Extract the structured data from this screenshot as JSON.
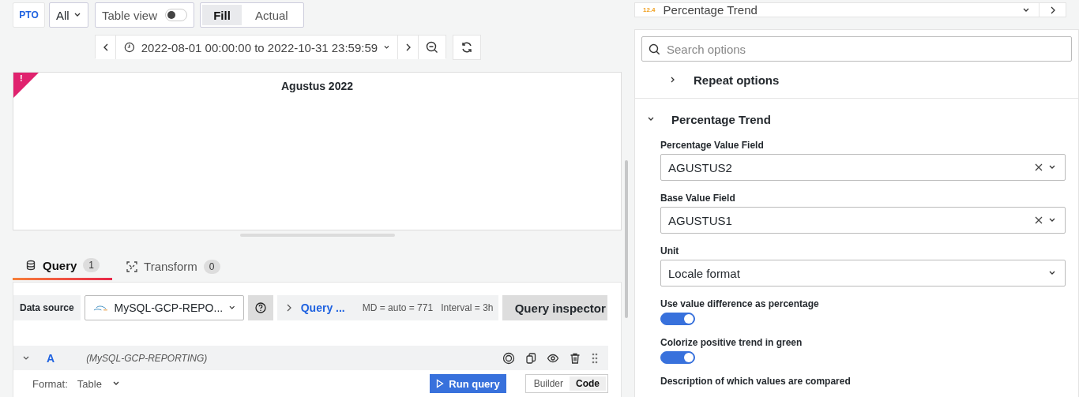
{
  "toolbar": {
    "pto_button": "PTO",
    "variable_dropdown": "All",
    "table_view": {
      "label": "Table view",
      "on": false
    },
    "fill_modes": [
      {
        "label": "Fill",
        "selected": true
      },
      {
        "label": "Actual",
        "selected": false
      }
    ]
  },
  "time_range": {
    "value": "2022-08-01 00:00:00 to 2022-10-31 23:59:59"
  },
  "panel": {
    "title": "Agustus 2022",
    "error_mark": "!"
  },
  "editor_tabs": [
    {
      "label": "Query",
      "count": "1",
      "selected": true
    },
    {
      "label": "Transform",
      "count": "0",
      "selected": false
    }
  ],
  "data_source": {
    "label": "Data source",
    "value": "MySQL-GCP-REPO..."
  },
  "query_options": {
    "label": "Query ...",
    "max_data_points": "MD = auto = 771",
    "interval": "Interval = 3h"
  },
  "query_inspector": "Query inspector",
  "query": {
    "name": "A",
    "source": "(MySQL-GCP-REPORTING)",
    "expanded": true,
    "format_label": "Format:",
    "format_value": "Table",
    "run_button": "Run query",
    "modes": [
      {
        "label": "Builder",
        "selected": false
      },
      {
        "label": "Code",
        "selected": true
      }
    ]
  },
  "visualization": {
    "logo_text": "12.4",
    "name": "Percentage Trend"
  },
  "options": {
    "search_placeholder": "Search options",
    "sections": [
      {
        "title": "Repeat options",
        "expanded": false
      },
      {
        "title": "Percentage Trend",
        "expanded": true,
        "fields": [
          {
            "kind": "select",
            "label": "Percentage Value Field",
            "value": "AGUSTUS2",
            "clearable": true
          },
          {
            "kind": "select",
            "label": "Base Value Field",
            "value": "AGUSTUS1",
            "clearable": true
          },
          {
            "kind": "select",
            "label": "Unit",
            "value": "Locale format",
            "clearable": false
          },
          {
            "kind": "switch",
            "label": "Use value difference as percentage",
            "on": true
          },
          {
            "kind": "switch",
            "label": "Colorize positive trend in green",
            "on": true
          },
          {
            "kind": "label",
            "label": "Description of which values are compared"
          }
        ]
      }
    ]
  }
}
